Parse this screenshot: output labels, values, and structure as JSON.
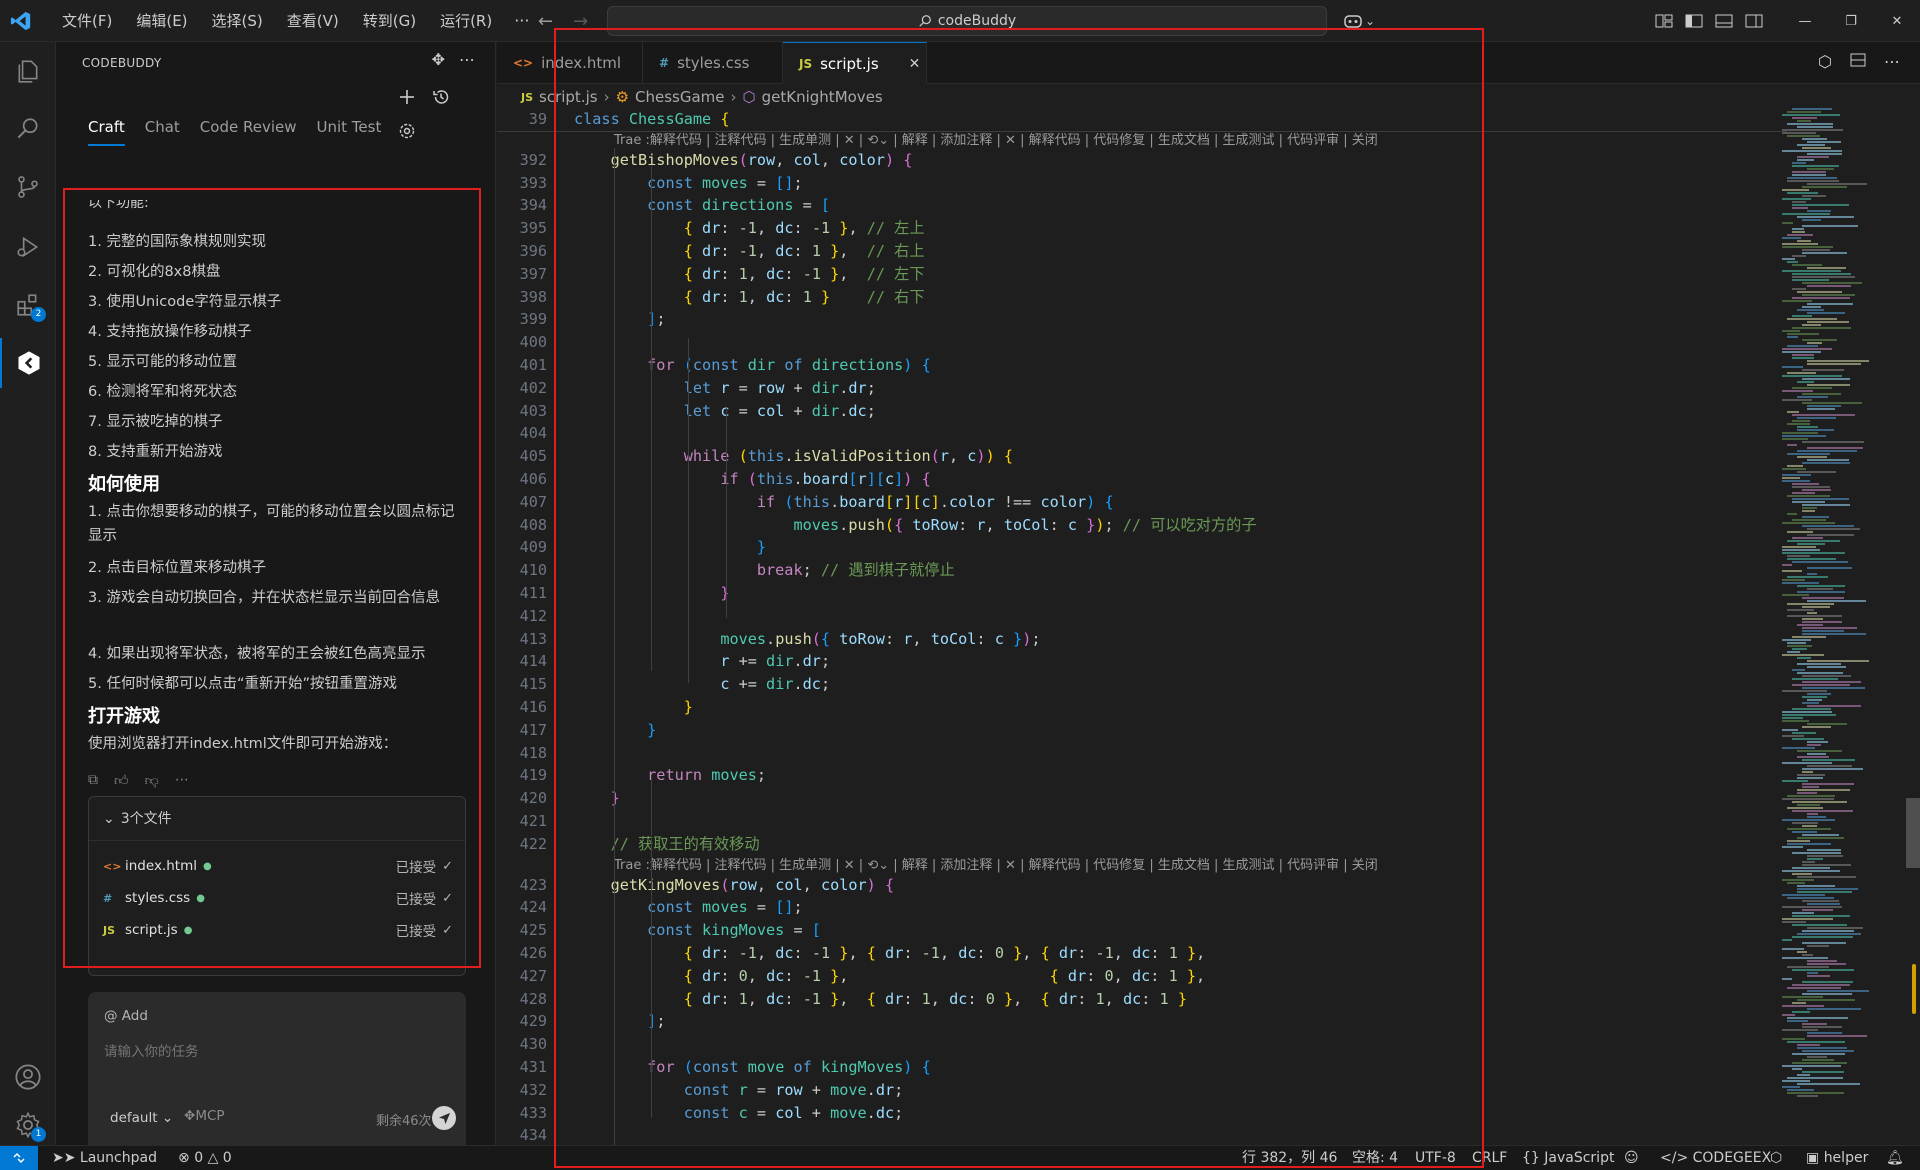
{
  "titlebar": {
    "menus": [
      "文件(F)",
      "编辑(E)",
      "选择(S)",
      "查看(V)",
      "转到(G)",
      "运行(R)"
    ],
    "more": "···",
    "search_text": "codeBuddy"
  },
  "side_panel": {
    "title": "CODEBUDDY",
    "tabs": [
      "Craft",
      "Chat",
      "Code Review",
      "Unit Test"
    ],
    "cut_line": "以下功能:",
    "features": [
      "1. 完整的国际象棋规则实现",
      "2. 可视化的8x8棋盘",
      "3. 使用Unicode字符显示棋子",
      "4. 支持拖放操作移动棋子",
      "5. 显示可能的移动位置",
      "6. 检测将军和将死状态",
      "7. 显示被吃掉的棋子",
      "8. 支持重新开始游戏"
    ],
    "heading_usage": "如何使用",
    "usage": [
      "1. 点击你想要移动的棋子，可能的移动位置会以圆点标记显示",
      "2. 点击目标位置来移动棋子",
      "3. 游戏会自动切换回合，并在状态栏显示当前回合信息",
      "4. 如果出现将军状态，被将军的王会被红色高亮显示",
      "5. 任何时候都可以点击“重新开始”按钮重置游戏"
    ],
    "heading_open": "打开游戏",
    "open_text": "使用浏览器打开index.html文件即可开始游戏：",
    "files_header": "3个文件",
    "files": [
      {
        "icon": "<>",
        "name": "index.html",
        "status": "已接受"
      },
      {
        "icon": "#",
        "name": "styles.css",
        "status": "已接受"
      },
      {
        "icon": "JS",
        "name": "script.js",
        "status": "已接受"
      }
    ],
    "input": {
      "add_label": "@ Add",
      "placeholder": "请输入你的任务",
      "mode": "default",
      "mcp": "MCP",
      "remaining": "剩余46次"
    }
  },
  "editor": {
    "tabs": [
      {
        "icon": "<>",
        "label": "index.html"
      },
      {
        "icon": "#",
        "label": "styles.css"
      },
      {
        "icon": "JS",
        "label": "script.js"
      }
    ],
    "breadcrumb": [
      "script.js",
      "ChessGame",
      "getKnightMoves"
    ],
    "codelens": "Trae :解释代码 | 注释代码 | 生成单测 | ✕ | ⟲⌄ | 解释 | 添加注释 | ✕ | 解释代码 | 代码修复 | 生成文档 | 生成测试 | 代码评审 | 关闭",
    "lines": [
      {
        "n": "39",
        "html": "<span class='k'>class</span> <span class='c'>ChessGame</span> <span class='br'>{</span>"
      },
      {
        "n": "392",
        "html": "    <span class='f'>getBishopMoves</span><span class='br2'>(</span><span class='v'>row</span>, <span class='v'>col</span>, <span class='v'>color</span><span class='br2'>)</span> <span class='br2'>{</span>"
      },
      {
        "n": "393",
        "html": "        <span class='k'>const</span> <span class='c'>moves</span> = <span class='br3'>[]</span>;"
      },
      {
        "n": "394",
        "html": "        <span class='k'>const</span> <span class='c'>directions</span> = <span class='br3'>[</span>"
      },
      {
        "n": "395",
        "html": "            <span class='br'>{</span> <span class='v'>dr</span>: <span class='n'>-1</span>, <span class='v'>dc</span>: <span class='n'>-1</span> <span class='br'>}</span>, <span class='cm'>// 左上</span>"
      },
      {
        "n": "396",
        "html": "            <span class='br'>{</span> <span class='v'>dr</span>: <span class='n'>-1</span>, <span class='v'>dc</span>: <span class='n'>1</span> <span class='br'>}</span>,  <span class='cm'>// 右上</span>"
      },
      {
        "n": "397",
        "html": "            <span class='br'>{</span> <span class='v'>dr</span>: <span class='n'>1</span>, <span class='v'>dc</span>: <span class='n'>-1</span> <span class='br'>}</span>,  <span class='cm'>// 左下</span>"
      },
      {
        "n": "398",
        "html": "            <span class='br'>{</span> <span class='v'>dr</span>: <span class='n'>1</span>, <span class='v'>dc</span>: <span class='n'>1</span> <span class='br'>}</span>    <span class='cm'>// 右下</span>"
      },
      {
        "n": "399",
        "html": "        <span class='br3'>]</span>;"
      },
      {
        "n": "400",
        "html": ""
      },
      {
        "n": "401",
        "html": "        <span class='kw'>for</span> <span class='br3'>(</span><span class='k'>const</span> <span class='c'>dir</span> <span class='k'>of</span> <span class='c'>directions</span><span class='br3'>)</span> <span class='br3'>{</span>"
      },
      {
        "n": "402",
        "html": "            <span class='k'>let</span> <span class='v'>r</span> = <span class='v'>row</span> + <span class='c'>dir</span>.<span class='v'>dr</span>;"
      },
      {
        "n": "403",
        "html": "            <span class='k'>let</span> <span class='v'>c</span> = <span class='v'>col</span> + <span class='c'>dir</span>.<span class='v'>dc</span>;"
      },
      {
        "n": "404",
        "html": ""
      },
      {
        "n": "405",
        "html": "            <span class='kw'>while</span> <span class='br'>(</span><span class='k'>this</span>.<span class='f'>isValidPosition</span><span class='br2'>(</span><span class='v'>r</span>, <span class='v'>c</span><span class='br2'>)</span><span class='br'>)</span> <span class='br'>{</span>"
      },
      {
        "n": "406",
        "html": "                <span class='kw'>if</span> <span class='br2'>(</span><span class='k'>this</span>.<span class='v'>board</span><span class='br3'>[</span><span class='v'>r</span><span class='br3'>][</span><span class='v'>c</span><span class='br3'>]</span><span class='br2'>)</span> <span class='br2'>{</span>"
      },
      {
        "n": "407",
        "html": "                    <span class='kw'>if</span> <span class='br3'>(</span><span class='k'>this</span>.<span class='v'>board</span><span class='br'>[</span><span class='v'>r</span><span class='br'>][</span><span class='v'>c</span><span class='br'>]</span>.<span class='v'>color</span> !== <span class='v'>color</span><span class='br3'>)</span> <span class='br3'>{</span>"
      },
      {
        "n": "408",
        "html": "                        <span class='c'>moves</span>.<span class='f'>push</span><span class='br'>(</span><span class='br2'>{</span> <span class='v'>toRow</span>: <span class='v'>r</span>, <span class='v'>toCol</span>: <span class='v'>c</span> <span class='br2'>}</span><span class='br'>)</span>; <span class='cm'>// 可以吃对方的子</span>"
      },
      {
        "n": "409",
        "html": "                    <span class='br3'>}</span>"
      },
      {
        "n": "410",
        "html": "                    <span class='kw'>break</span>; <span class='cm'>// 遇到棋子就停止</span>"
      },
      {
        "n": "411",
        "html": "                <span class='br2'>}</span>"
      },
      {
        "n": "412",
        "html": ""
      },
      {
        "n": "413",
        "html": "                <span class='c'>moves</span>.<span class='f'>push</span><span class='br2'>(</span><span class='br3'>{</span> <span class='v'>toRow</span>: <span class='v'>r</span>, <span class='v'>toCol</span>: <span class='v'>c</span> <span class='br3'>}</span><span class='br2'>)</span>;"
      },
      {
        "n": "414",
        "html": "                <span class='v'>r</span> += <span class='c'>dir</span>.<span class='v'>dr</span>;"
      },
      {
        "n": "415",
        "html": "                <span class='v'>c</span> += <span class='c'>dir</span>.<span class='v'>dc</span>;"
      },
      {
        "n": "416",
        "html": "            <span class='br'>}</span>"
      },
      {
        "n": "417",
        "html": "        <span class='br3'>}</span>"
      },
      {
        "n": "418",
        "html": ""
      },
      {
        "n": "419",
        "html": "        <span class='kw'>return</span> <span class='c'>moves</span>;"
      },
      {
        "n": "420",
        "html": "    <span class='br2'>}</span>"
      },
      {
        "n": "421",
        "html": ""
      },
      {
        "n": "422",
        "html": "    <span class='cm'>// 获取王的有效移动</span>"
      },
      {
        "n": "423",
        "html": "    <span class='f'>getKingMoves</span><span class='br2'>(</span><span class='v'>row</span>, <span class='v'>col</span>, <span class='v'>color</span><span class='br2'>)</span> <span class='br2'>{</span>"
      },
      {
        "n": "424",
        "html": "        <span class='k'>const</span> <span class='c'>moves</span> = <span class='br3'>[]</span>;"
      },
      {
        "n": "425",
        "html": "        <span class='k'>const</span> <span class='c'>kingMoves</span> = <span class='br3'>[</span>"
      },
      {
        "n": "426",
        "html": "            <span class='br'>{</span> <span class='v'>dr</span>: <span class='n'>-1</span>, <span class='v'>dc</span>: <span class='n'>-1</span> <span class='br'>}</span>, <span class='br'>{</span> <span class='v'>dr</span>: <span class='n'>-1</span>, <span class='v'>dc</span>: <span class='n'>0</span> <span class='br'>}</span>, <span class='br'>{</span> <span class='v'>dr</span>: <span class='n'>-1</span>, <span class='v'>dc</span>: <span class='n'>1</span> <span class='br'>}</span>,"
      },
      {
        "n": "427",
        "html": "            <span class='br'>{</span> <span class='v'>dr</span>: <span class='n'>0</span>, <span class='v'>dc</span>: <span class='n'>-1</span> <span class='br'>}</span>,                      <span class='br'>{</span> <span class='v'>dr</span>: <span class='n'>0</span>, <span class='v'>dc</span>: <span class='n'>1</span> <span class='br'>}</span>,"
      },
      {
        "n": "428",
        "html": "            <span class='br'>{</span> <span class='v'>dr</span>: <span class='n'>1</span>, <span class='v'>dc</span>: <span class='n'>-1</span> <span class='br'>}</span>,  <span class='br'>{</span> <span class='v'>dr</span>: <span class='n'>1</span>, <span class='v'>dc</span>: <span class='n'>0</span> <span class='br'>}</span>,  <span class='br'>{</span> <span class='v'>dr</span>: <span class='n'>1</span>, <span class='v'>dc</span>: <span class='n'>1</span> <span class='br'>}</span>"
      },
      {
        "n": "429",
        "html": "        <span class='br3'>]</span>;"
      },
      {
        "n": "430",
        "html": ""
      },
      {
        "n": "431",
        "html": "        <span class='kw'>for</span> <span class='br3'>(</span><span class='k'>const</span> <span class='c'>move</span> <span class='k'>of</span> <span class='c'>kingMoves</span><span class='br3'>)</span> <span class='br3'>{</span>"
      },
      {
        "n": "432",
        "html": "            <span class='k'>const</span> <span class='c'>r</span> = <span class='v'>row</span> + <span class='c'>move</span>.<span class='v'>dr</span>;"
      },
      {
        "n": "433",
        "html": "            <span class='k'>const</span> <span class='c'>c</span> = <span class='v'>col</span> + <span class='c'>move</span>.<span class='v'>dc</span>;"
      },
      {
        "n": "434",
        "html": ""
      }
    ]
  },
  "statusbar": {
    "launchpad": "Launchpad",
    "errors": "0",
    "warnings": "0",
    "position": "行 382，列 46",
    "spaces": "空格: 4",
    "encoding": "UTF-8",
    "eol": "CRLF",
    "language": "JavaScript",
    "codegeex": "CODEGEEX",
    "helper": "helper"
  },
  "colors": {
    "accent": "#0078d4",
    "highlight_box": "#e11d1d"
  }
}
